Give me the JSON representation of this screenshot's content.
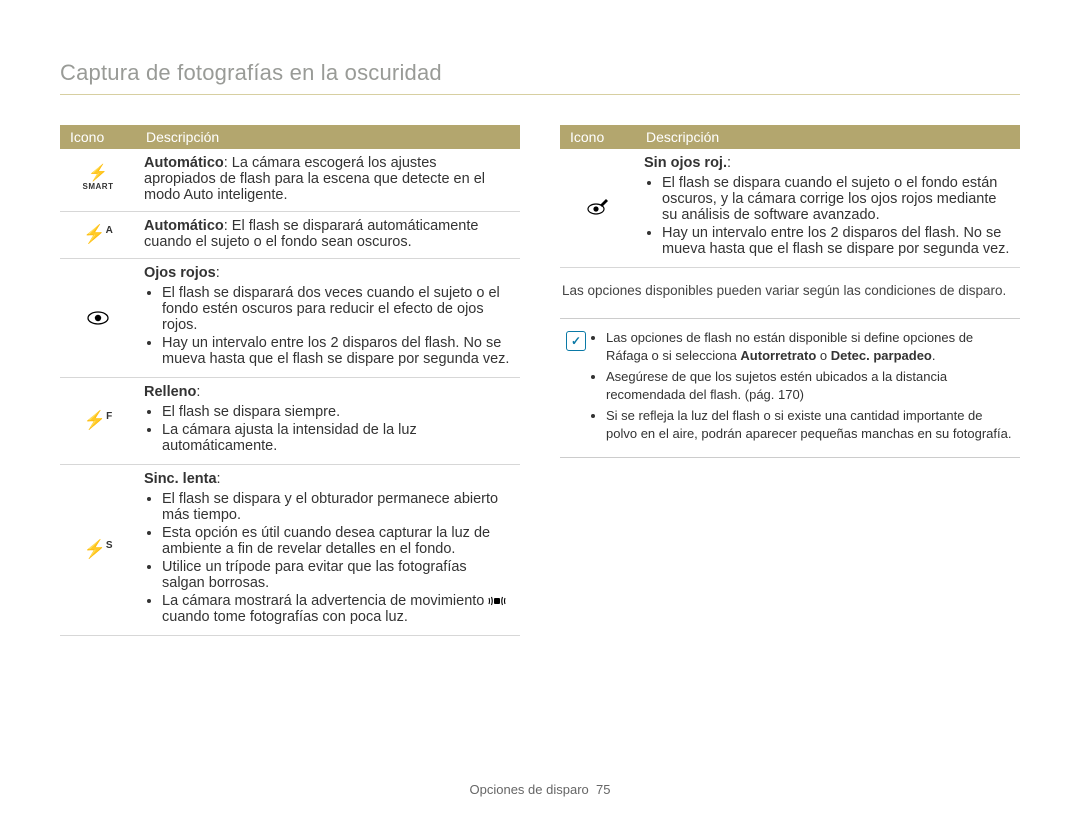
{
  "title": "Captura de fotografías en la oscuridad",
  "table_headers": {
    "icon": "Icono",
    "desc": "Descripción"
  },
  "left_rows": [
    {
      "icon": "smart",
      "lead_bold": "Automático",
      "lead_rest": ": La cámara escogerá los ajustes apropiados de flash para la escena que detecte en el modo Auto inteligente.",
      "bullets": []
    },
    {
      "icon": "flash-a",
      "lead_bold": "Automático",
      "lead_rest": ": El flash se disparará automáticamente cuando el sujeto o el fondo sean oscuros.",
      "bullets": []
    },
    {
      "icon": "eye",
      "lead_bold": "Ojos rojos",
      "lead_rest": ":",
      "bullets": [
        "El flash se disparará dos veces cuando el sujeto o el fondo estén oscuros para reducir el efecto de ojos rojos.",
        "Hay un intervalo entre los 2 disparos del flash. No se mueva hasta que el flash se dispare por segunda vez."
      ]
    },
    {
      "icon": "flash-f",
      "lead_bold": "Relleno",
      "lead_rest": ":",
      "bullets": [
        "El flash se dispara siempre.",
        "La cámara ajusta la intensidad de la luz automáticamente."
      ]
    },
    {
      "icon": "flash-s",
      "lead_bold": "Sinc. lenta",
      "lead_rest": ":",
      "bullets": [
        "El flash se dispara y el obturador permanece abierto más tiempo.",
        "Esta opción es útil cuando desea capturar la luz de ambiente a fin de revelar detalles en el fondo.",
        "Utilice un trípode para evitar que las fotografías salgan borrosas.",
        "La cámara mostrará la advertencia de movimiento __SHAKE__ cuando tome fotografías con poca luz."
      ]
    }
  ],
  "right_rows": [
    {
      "icon": "pencil",
      "lead_bold": "Sin ojos roj.",
      "lead_rest": ":",
      "bullets": [
        "El flash se dispara cuando el sujeto o el fondo están oscuros, y la cámara corrige los ojos rojos mediante su análisis de software avanzado.",
        "Hay un intervalo entre los 2 disparos del flash. No se mueva hasta que el flash se dispare por segunda vez."
      ]
    }
  ],
  "availability_note": "Las opciones disponibles pueden variar según las condiciones de disparo.",
  "info_bullets": [
    {
      "pre": "Las opciones de flash no están disponible si define opciones de Ráfaga o si selecciona ",
      "bold1": "Autorretrato",
      "mid": " o ",
      "bold2": "Detec. parpadeo",
      "post": "."
    },
    {
      "pre": "Asegúrese de que los sujetos estén ubicados a la distancia recomendada del flash. (pág. 170)",
      "bold1": "",
      "mid": "",
      "bold2": "",
      "post": ""
    },
    {
      "pre": "Si se refleja la luz del flash o si existe una cantidad importante de polvo en el aire, podrán aparecer pequeñas manchas en su fotografía.",
      "bold1": "",
      "mid": "",
      "bold2": "",
      "post": ""
    }
  ],
  "footer": {
    "section": "Opciones de disparo",
    "page": "75"
  }
}
